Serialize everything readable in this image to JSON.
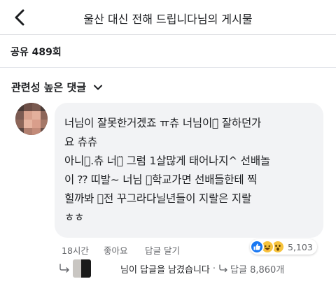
{
  "header": {
    "title": "울산 대신 전해 드립니다님의 게시물"
  },
  "post": {
    "share_count": "공유 489회"
  },
  "comments_section": {
    "sort_label": "관련성 높은 댓글"
  },
  "comment": {
    "lines": [
      "너님이 잘못한거겠죠 ㅠ츄 너님이ㄴ̈ 잘하던가",
      "요 츄츄",
      "아니ㄴ̤.츄 너ㄱ̈ 그럼 1살많게 태어나지^ 선배놀",
      "이 ⁇ 띠발~ 너님 중̤학교가면 선배들한테 찍",
      "힐까봐 와̤전 꾸그라다닐년들이 지랄은 지랄",
      "ㅎㅎ"
    ],
    "time": "18시간",
    "like_action": "좋아요",
    "reply_action": "답글 달기",
    "reaction_count": "5,103",
    "reactions": [
      "like",
      "haha",
      "wow"
    ]
  },
  "reply_preview": {
    "text": "님이 답글을 남겼습니다",
    "separator": "·",
    "count_text": "답글 8,860개"
  },
  "colors": {
    "meta_gray": "#65676b",
    "bubble_bg": "#f2f3f5",
    "like_blue": "#1877f2",
    "emoji_yellow": "#f7c33c"
  }
}
